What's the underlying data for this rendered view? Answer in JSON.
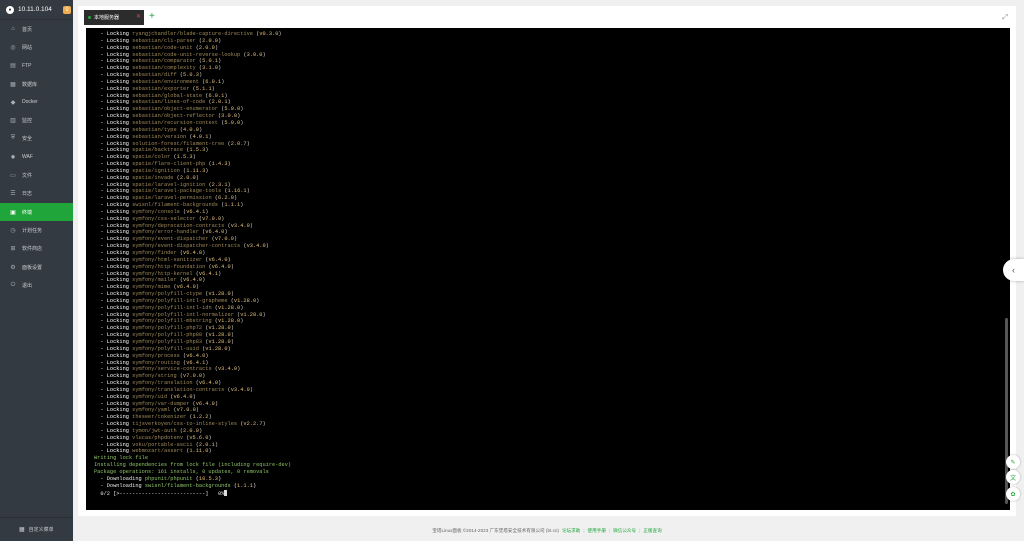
{
  "sidebar": {
    "ip": "10.11.0.104",
    "badge": "0",
    "items": [
      {
        "label": "首页",
        "icon": "⌂"
      },
      {
        "label": "网站",
        "icon": "◎"
      },
      {
        "label": "FTP",
        "icon": "▤"
      },
      {
        "label": "数据库",
        "icon": "▦"
      },
      {
        "label": "Docker",
        "icon": "◆"
      },
      {
        "label": "监控",
        "icon": "▥"
      },
      {
        "label": "安全",
        "icon": "⛨"
      },
      {
        "label": "WAF",
        "icon": "✹"
      },
      {
        "label": "文件",
        "icon": "▭"
      },
      {
        "label": "日志",
        "icon": "☰"
      },
      {
        "label": "终端",
        "icon": "▣"
      },
      {
        "label": "计划任务",
        "icon": "◷"
      },
      {
        "label": "软件商店",
        "icon": "⊞"
      },
      {
        "label": "面板设置",
        "icon": "⚙"
      },
      {
        "label": "退出",
        "icon": "⏻"
      }
    ],
    "active_index": 10,
    "footer_label": "自定义菜单"
  },
  "tabs": [
    {
      "label": "本地服务器"
    }
  ],
  "terminal": {
    "locks": [
      [
        "ryangjchandler/blade-capture-directive",
        "v0.3.0"
      ],
      [
        "sebastian/cli-parser",
        "2.0.0"
      ],
      [
        "sebastian/code-unit",
        "2.0.0"
      ],
      [
        "sebastian/code-unit-reverse-lookup",
        "3.0.0"
      ],
      [
        "sebastian/comparator",
        "5.0.1"
      ],
      [
        "sebastian/complexity",
        "3.1.0"
      ],
      [
        "sebastian/diff",
        "5.0.3"
      ],
      [
        "sebastian/environment",
        "6.0.1"
      ],
      [
        "sebastian/exporter",
        "5.1.1"
      ],
      [
        "sebastian/global-state",
        "6.0.1"
      ],
      [
        "sebastian/lines-of-code",
        "2.0.1"
      ],
      [
        "sebastian/object-enumerator",
        "5.0.0"
      ],
      [
        "sebastian/object-reflector",
        "3.0.0"
      ],
      [
        "sebastian/recursion-context",
        "5.0.0"
      ],
      [
        "sebastian/type",
        "4.0.0"
      ],
      [
        "sebastian/version",
        "4.0.1"
      ],
      [
        "solution-forest/filament-tree",
        "2.0.7"
      ],
      [
        "spatie/backtrace",
        "1.5.3"
      ],
      [
        "spatie/color",
        "1.5.3"
      ],
      [
        "spatie/flare-client-php",
        "1.4.3"
      ],
      [
        "spatie/ignition",
        "1.11.3"
      ],
      [
        "spatie/invade",
        "2.0.0"
      ],
      [
        "spatie/laravel-ignition",
        "2.3.1"
      ],
      [
        "spatie/laravel-package-tools",
        "1.16.1"
      ],
      [
        "spatie/laravel-permission",
        "6.2.0"
      ],
      [
        "swisnl/filament-backgrounds",
        "1.1.1"
      ],
      [
        "symfony/console",
        "v6.4.1"
      ],
      [
        "symfony/css-selector",
        "v7.0.0"
      ],
      [
        "symfony/deprecation-contracts",
        "v3.4.0"
      ],
      [
        "symfony/error-handler",
        "v6.4.0"
      ],
      [
        "symfony/event-dispatcher",
        "v7.0.0"
      ],
      [
        "symfony/event-dispatcher-contracts",
        "v3.4.0"
      ],
      [
        "symfony/finder",
        "v6.4.0"
      ],
      [
        "symfony/html-sanitizer",
        "v6.4.0"
      ],
      [
        "symfony/http-foundation",
        "v6.4.0"
      ],
      [
        "symfony/http-kernel",
        "v6.4.1"
      ],
      [
        "symfony/mailer",
        "v6.4.0"
      ],
      [
        "symfony/mime",
        "v6.4.0"
      ],
      [
        "symfony/polyfill-ctype",
        "v1.28.0"
      ],
      [
        "symfony/polyfill-intl-grapheme",
        "v1.28.0"
      ],
      [
        "symfony/polyfill-intl-idn",
        "v1.28.0"
      ],
      [
        "symfony/polyfill-intl-normalizer",
        "v1.28.0"
      ],
      [
        "symfony/polyfill-mbstring",
        "v1.28.0"
      ],
      [
        "symfony/polyfill-php72",
        "v1.28.0"
      ],
      [
        "symfony/polyfill-php80",
        "v1.28.0"
      ],
      [
        "symfony/polyfill-php83",
        "v1.28.0"
      ],
      [
        "symfony/polyfill-uuid",
        "v1.28.0"
      ],
      [
        "symfony/process",
        "v6.4.0"
      ],
      [
        "symfony/routing",
        "v6.4.1"
      ],
      [
        "symfony/service-contracts",
        "v3.4.0"
      ],
      [
        "symfony/string",
        "v7.0.0"
      ],
      [
        "symfony/translation",
        "v6.4.0"
      ],
      [
        "symfony/translation-contracts",
        "v3.4.0"
      ],
      [
        "symfony/uid",
        "v6.4.0"
      ],
      [
        "symfony/var-dumper",
        "v6.4.0"
      ],
      [
        "symfony/yaml",
        "v7.0.0"
      ],
      [
        "theseer/tokenizer",
        "1.2.2"
      ],
      [
        "tijsverkoyen/css-to-inline-styles",
        "v2.2.7"
      ],
      [
        "tymon/jwt-auth",
        "2.0.0"
      ],
      [
        "vlucas/phpdotenv",
        "v5.6.0"
      ],
      [
        "voku/portable-ascii",
        "2.0.1"
      ],
      [
        "webmozart/assert",
        "1.11.0"
      ]
    ],
    "status_lines": [
      "Writing lock file",
      "Installing dependencies from lock file (including require-dev)",
      "Package operations: 161 installs, 0 updates, 0 removals"
    ],
    "downloads": [
      [
        "phpunit/phpunit",
        "10.5.3"
      ],
      [
        "swisnl/filament-backgrounds",
        "1.1.1"
      ]
    ],
    "progress_text": "  0/2 [>---------------------------]   0%"
  },
  "footer": {
    "copyright": "宝塔Linux面板 ©2014-2023 广东堡塔安全技术有限公司 (bt.cn)",
    "links": [
      "论坛求助",
      "使用手册",
      "微信公众号",
      "正版查询"
    ]
  }
}
